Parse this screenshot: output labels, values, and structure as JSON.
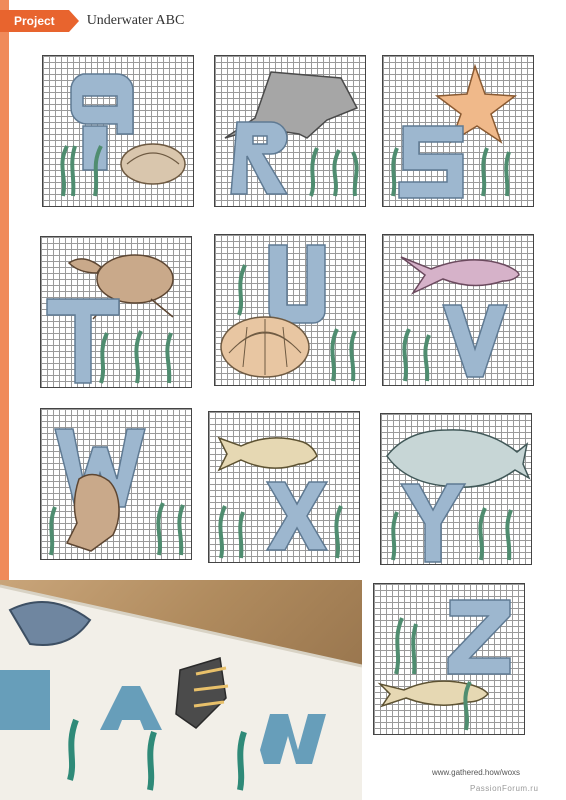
{
  "header": {
    "section_tag": "Project",
    "title": "Underwater ABC"
  },
  "charts": [
    {
      "letter": "Q",
      "motif": "shell"
    },
    {
      "letter": "R",
      "motif": "stingray"
    },
    {
      "letter": "S",
      "motif": "starfish"
    },
    {
      "letter": "T",
      "motif": "turtle"
    },
    {
      "letter": "U",
      "motif": "sea-urchin"
    },
    {
      "letter": "V",
      "motif": "fish"
    },
    {
      "letter": "W",
      "motif": "walrus"
    },
    {
      "letter": "X",
      "motif": "fish"
    },
    {
      "letter": "Y",
      "motif": "fish"
    },
    {
      "letter": "Z",
      "motif": "fish"
    }
  ],
  "footer": {
    "url": "www.gathered.how/woxs"
  },
  "watermark": "PassionForum.ru",
  "colors": {
    "accent": "#e8642e",
    "letter_blue": "#9db7cf",
    "seaweed_green": "#7fb7a0",
    "grid_line": "#9a9a9a"
  }
}
